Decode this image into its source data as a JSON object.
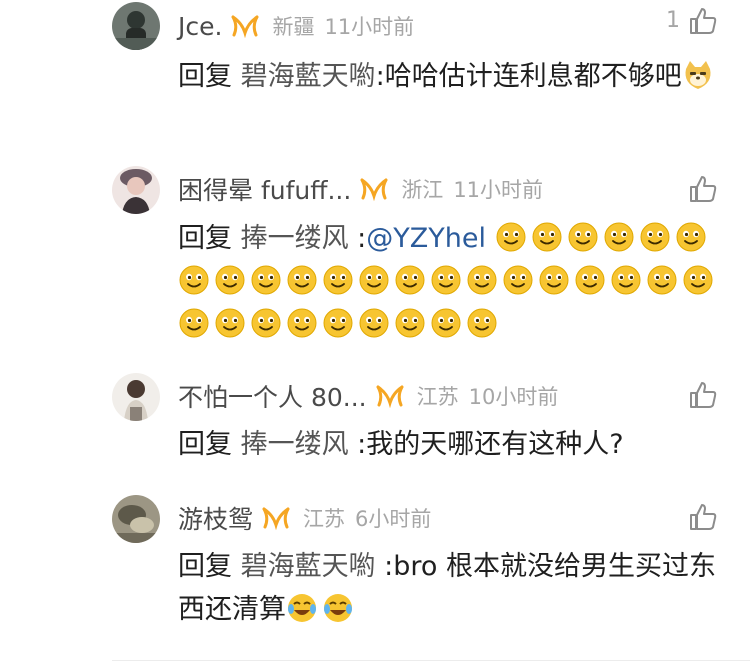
{
  "comments": [
    {
      "username": "Jce.",
      "location": "新疆",
      "time": "11小时前",
      "like_count": "1",
      "reply_prefix": "回复 ",
      "reply_target": "碧海藍天喲",
      "text": ":哈哈估计连利息都不够吧",
      "avatar_color": "#3f4b45"
    },
    {
      "username": "困得晕 fufuff...",
      "location": "浙江",
      "time": "11小时前",
      "reply_prefix": "回复 ",
      "reply_target": "捧一缕风",
      "text_prefix": " :",
      "mention": "@YZYhel",
      "smile_emoji_count": 30,
      "avatar_color": "#d9c3c0"
    },
    {
      "username": "不怕一个人 80...",
      "location": "江苏",
      "time": "10小时前",
      "reply_prefix": "回复 ",
      "reply_target": "捧一缕风",
      "text": " :我的天哪还有这种人?",
      "avatar_color": "#bdb5ad"
    },
    {
      "username": "游枝鸳",
      "location": "江苏",
      "time": "6小时前",
      "reply_prefix": "回复 ",
      "reply_target": "碧海藍天喲",
      "text": " :bro 根本就没给男生买过东西还清算",
      "avatar_color": "#8e8a78"
    }
  ],
  "colors": {
    "vip_orange": "#f5a623",
    "username": "#4a4a4a",
    "meta": "#a6a6a6",
    "mention": "#2b5b9b"
  },
  "icons": {
    "like": "thumbs-up-icon",
    "vip": "vip-badge-icon",
    "smile": "smile-emoji-icon",
    "doge": "doge-emoji-icon",
    "laugh_cry": "laugh-cry-emoji-icon"
  }
}
